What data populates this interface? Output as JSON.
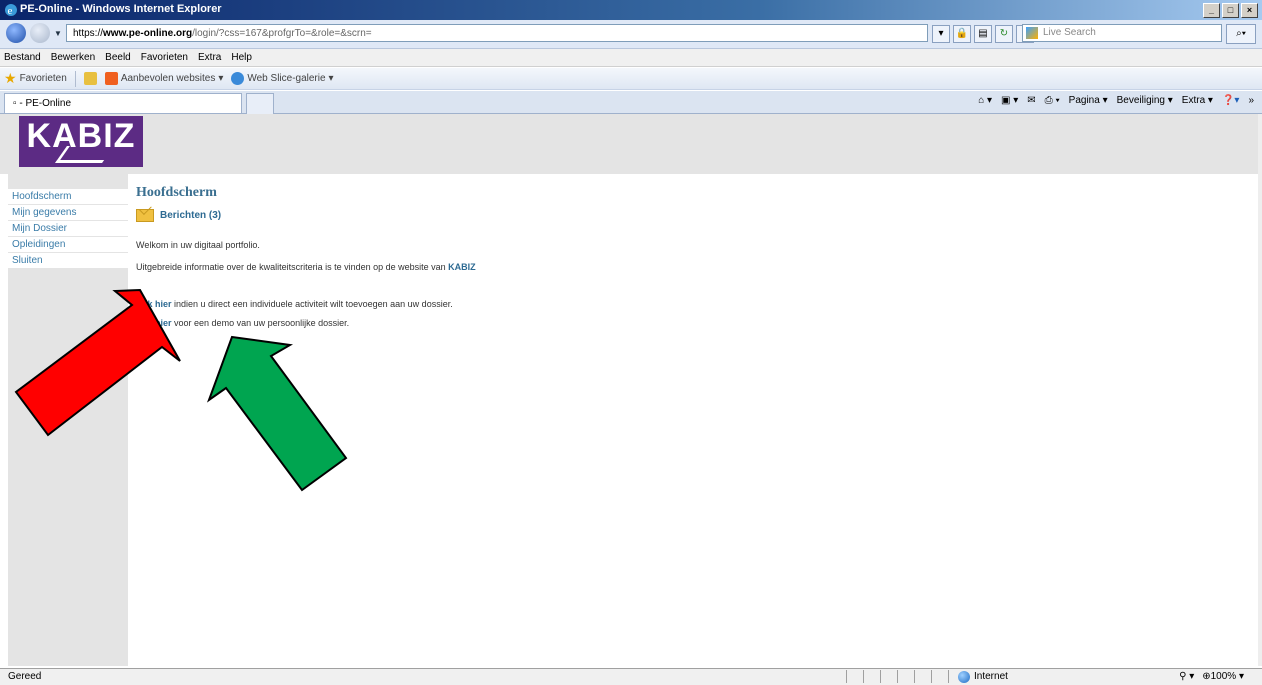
{
  "window": {
    "title": "PE-Online - Windows Internet Explorer"
  },
  "address": {
    "proto": "https://",
    "domain": "www.pe-online.org",
    "path": "/login/?css=167&profgrTo=&role=&scrn="
  },
  "search": {
    "placeholder": "Live Search"
  },
  "menu": {
    "items": [
      "Bestand",
      "Bewerken",
      "Beeld",
      "Favorieten",
      "Extra",
      "Help"
    ]
  },
  "favorites": {
    "label": "Favorieten",
    "links": [
      "Aanbevolen websites",
      "Web Slice-galerie"
    ]
  },
  "tab": {
    "title": "PE-Online"
  },
  "commandbar": {
    "items": [
      "Pagina",
      "Beveiliging",
      "Extra"
    ]
  },
  "logo": {
    "text": "KABIZ"
  },
  "sidebar": {
    "items": [
      "Hoofdscherm",
      "Mijn gegevens",
      "Mijn Dossier",
      "Opleidingen",
      "Sluiten"
    ]
  },
  "main": {
    "title": "Hoofdscherm",
    "messages_link": "Berichten (3)",
    "welcome": "Welkom in uw digitaal portfolio.",
    "info_pre": "Uitgebreide informatie over de kwaliteitscriteria is te vinden op de website van",
    "info_link": "KABIZ",
    "line1_link": "Klik hier",
    "line1_text": "indien u direct een individuele activiteit wilt toevoegen aan uw dossier.",
    "line2_link": "Klik hier",
    "line2_text": "voor een demo van uw persoonlijke dossier."
  },
  "arrows": {
    "red": "#ff0000",
    "green": "#00a550"
  },
  "status": {
    "left": "Gereed",
    "zone": "Internet",
    "zoom": "100%"
  }
}
